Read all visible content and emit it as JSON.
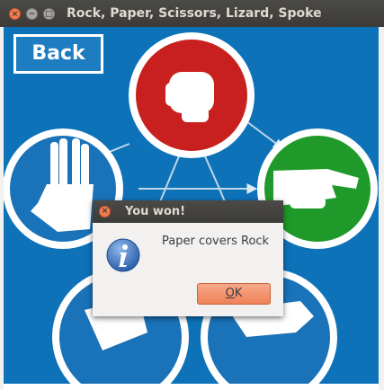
{
  "window": {
    "title": "Rock, Paper, Scissors, Lizard, Spoke",
    "controls": {
      "close_glyph": "×",
      "minimize_glyph": "−",
      "maximize_glyph": "□"
    }
  },
  "game": {
    "back_label": "Back",
    "choices": [
      "rock",
      "paper",
      "scissors",
      "lizard",
      "spock"
    ],
    "colors": {
      "background": "#0e72b9",
      "rock": "#c8201f",
      "paper": "#1f9a2a",
      "other": "#1a72b8",
      "ring": "#ffffff"
    }
  },
  "dialog": {
    "title": "You won!",
    "close_glyph": "×",
    "icon": "info-icon",
    "message": "Paper covers Rock",
    "ok_mnemonic": "O",
    "ok_rest": "K",
    "ok_accent": "#ef8158"
  }
}
